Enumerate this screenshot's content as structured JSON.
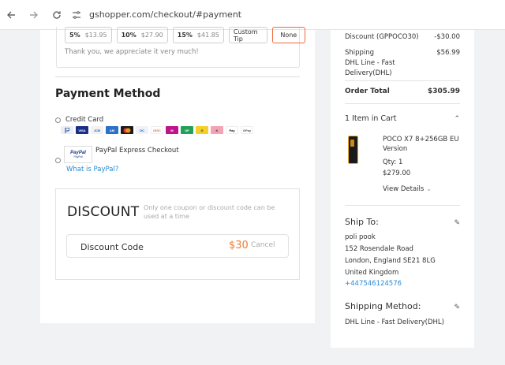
{
  "browser": {
    "url": "gshopper.com/checkout/#payment"
  },
  "tip": {
    "options": [
      {
        "pct": "5%",
        "amount": "$13.95"
      },
      {
        "pct": "10%",
        "amount": "$27.90"
      },
      {
        "pct": "15%",
        "amount": "$41.85"
      }
    ],
    "custom_label": "Custom Tip",
    "none_label": "None",
    "thanks": "Thank you, we appreciate it very much!"
  },
  "payment": {
    "title": "Payment Method",
    "credit_card_label": "Credit Card",
    "paypal_label": "PayPal Express Checkout",
    "paypal_logo_top": "PayPal",
    "paypal_logo_bottom": "PayPal",
    "what_is_paypal": "What is PayPal?"
  },
  "discount": {
    "title": "DISCOUNT",
    "note": "Only one coupon or discount code can be used at a time",
    "code_label": "Discount Code",
    "amount": "$30",
    "cancel": "Cancel"
  },
  "summary": {
    "discount_label": "Discount (GPPOCO30)",
    "discount_value": "-$30.00",
    "shipping_label": "Shipping",
    "shipping_value": "$56.99",
    "shipping_method_line1": "DHL Line - Fast",
    "shipping_method_line2": "Delivery(DHL)",
    "total_label": "Order Total",
    "total_value": "$305.99",
    "cart_title": "1 Item in Cart",
    "product_name_line1": "POCO X7 8+256GB EU",
    "product_name_line2": "Version",
    "qty": "Qty: 1",
    "price": "$279.00",
    "view_details": "View Details",
    "ship_to_title": "Ship To:",
    "ship_name": "poli pook",
    "ship_street": "152 Rosendale Road",
    "ship_city": "London, England SE21 8LG",
    "ship_country": "United Kingdom",
    "ship_phone": "+447546124576",
    "shipping_method_title": "Shipping Method:",
    "shipping_method_value": "DHL Line - Fast Delivery(DHL)"
  }
}
